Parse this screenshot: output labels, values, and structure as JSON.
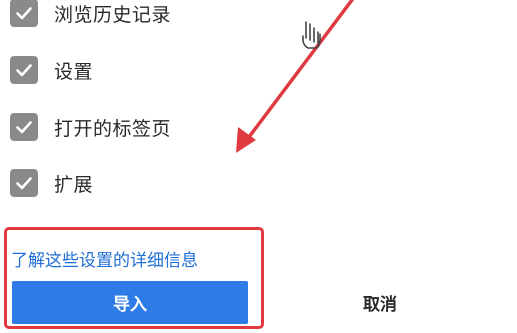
{
  "options": [
    {
      "label": "浏览历史记录",
      "checked": true
    },
    {
      "label": "设置",
      "checked": true
    },
    {
      "label": "打开的标签页",
      "checked": true
    },
    {
      "label": "扩展",
      "checked": true
    }
  ],
  "details_link": "了解这些设置的详细信息",
  "buttons": {
    "import_label": "导入",
    "cancel_label": "取消"
  },
  "colors": {
    "primary": "#2e7ae6",
    "link": "#1f6fd6",
    "annotation": "#e0393f",
    "checkbox": "#8a8a8a"
  },
  "icons": {
    "checkbox": "checkmark-icon",
    "cursor": "hand-pointer-icon",
    "annotation": "arrow-annotation"
  }
}
